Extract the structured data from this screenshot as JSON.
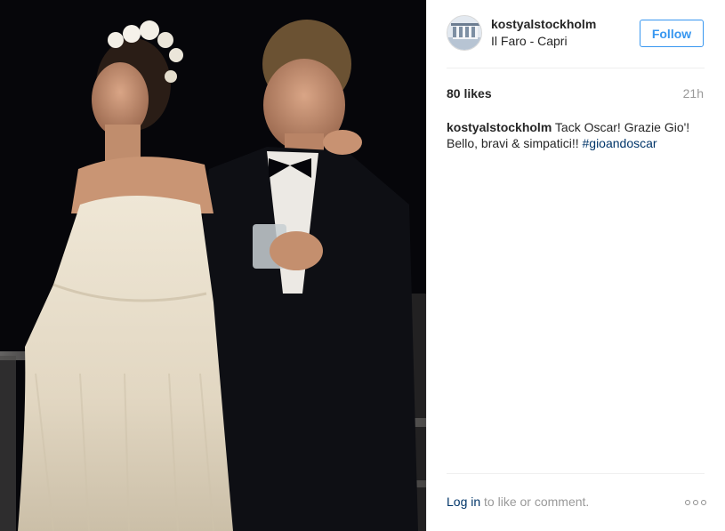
{
  "post": {
    "username": "kostyalstockholm",
    "location": "Il Faro - Capri",
    "follow_label": "Follow",
    "likes": "80 likes",
    "time_ago": "21h",
    "caption": {
      "username": "kostyalstockholm",
      "text": "Tack Oscar! Grazie Gio'! Bello, bravi & simpatici!! ",
      "hashtag": "#gioandoscar"
    },
    "footer": {
      "login_label": "Log in",
      "rest_text": " to like or comment."
    }
  },
  "colors": {
    "accent": "#3897f0",
    "link": "#003569",
    "muted": "#999999",
    "text": "#262626"
  },
  "icons": {
    "more": "more-options-icon"
  }
}
